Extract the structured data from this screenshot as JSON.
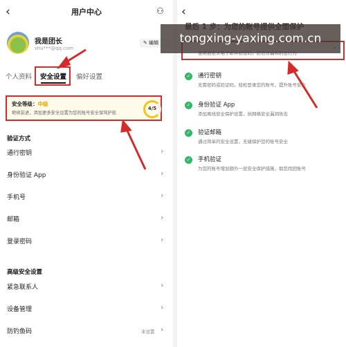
{
  "left": {
    "back_glyph": "‹",
    "title": "用户中心",
    "user_icon_glyph": "⚇",
    "profile": {
      "name": "我是团长",
      "email": "shu***@qq.com",
      "edit_label": "✎ 编辑"
    },
    "tabs": [
      "个人资料",
      "安全设置",
      "偏好设置"
    ],
    "security": {
      "label_prefix": "安全等级：",
      "level": "中级",
      "desc": "继续前进，添加更多安全设置为您的账号安全保驾护航",
      "score": "4/5"
    },
    "verification": {
      "heading": "验证方式",
      "items": [
        "通行密钥",
        "身份验证 App",
        "手机号",
        "邮箱",
        "登录密码"
      ]
    },
    "advanced": {
      "heading": "高级安全设置",
      "items": [
        "紧急联系人",
        "设备管理",
        "防钓鱼码"
      ],
      "anti_phishing_status": "未设置"
    },
    "chevron": "›"
  },
  "right": {
    "back_glyph": "‹",
    "title": "最后 1 步：为您的账号提供全面保护",
    "first_item_desc": "使用自定义电子邮件验证码，防范诈骗和钓鱼行为",
    "items": [
      {
        "name": "通行密钥",
        "desc": "无需密码或验证码，轻松登录您的账号，提升账号安全"
      },
      {
        "name": "身份验证 App",
        "desc": "添加离线安全保护设置，抗网络安全漏洞攻击"
      },
      {
        "name": "验证邮箱",
        "desc": "通过简单的安全设置，无缝保护您的账号安全"
      },
      {
        "name": "手机验证",
        "desc": "为您的账号增加额外一层安全保护措施，助您找回账号"
      }
    ],
    "check_glyph": "✓",
    "chevron": "›"
  },
  "watermark": "tongxing-yaxing.com.cn",
  "colors": {
    "annotation_red": "#d32a2a",
    "check_green": "#36b66a",
    "level_gold": "#e6a200"
  }
}
